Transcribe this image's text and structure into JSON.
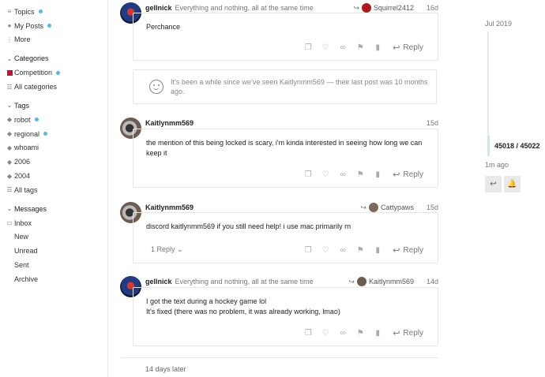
{
  "sidebar": {
    "top": [
      {
        "label": "Topics",
        "icon": "topics-icon",
        "dot": true
      },
      {
        "label": "My Posts",
        "icon": "user-icon",
        "dot": true
      },
      {
        "label": "More",
        "icon": "more-icon",
        "dot": false
      }
    ],
    "categories_title": "Categories",
    "categories": [
      {
        "label": "Competition",
        "icon": "category-square",
        "dot": true
      },
      {
        "label": "All categories",
        "icon": "list-icon",
        "dot": false
      }
    ],
    "tags_title": "Tags",
    "tags": [
      {
        "label": "robot",
        "dot": true
      },
      {
        "label": "regional",
        "dot": true
      },
      {
        "label": "whoami",
        "dot": false
      },
      {
        "label": "2006",
        "dot": false
      },
      {
        "label": "2004",
        "dot": false
      },
      {
        "label": "All tags",
        "dot": false
      }
    ],
    "messages_title": "Messages",
    "messages": [
      {
        "label": "Inbox"
      },
      {
        "label": "New"
      },
      {
        "label": "Unread"
      },
      {
        "label": "Sent"
      },
      {
        "label": "Archive"
      }
    ]
  },
  "posts": [
    {
      "username": "gellnick",
      "user_title": "Everything and nothing, all at the same time",
      "reply_to": "Squirrel2412",
      "age": "16d",
      "body": [
        "Perchance"
      ],
      "reply_label": "Reply",
      "replies": ""
    },
    {
      "username": "Kaitlynmm569",
      "user_title": "",
      "reply_to": "",
      "age": "15d",
      "body": [
        "the mention of this being locked is scary, i'm kinda interested in seeing how long we can keep it"
      ],
      "reply_label": "Reply",
      "replies": ""
    },
    {
      "username": "Kaitlynmm569",
      "user_title": "",
      "reply_to": "Cattypaws",
      "age": "15d",
      "body": [
        "discord kaitlynmm569 if you still need help! i use mac primarily rn"
      ],
      "reply_label": "Reply",
      "replies": "1 Reply"
    },
    {
      "username": "gellnick",
      "user_title": "Everything and nothing, all at the same time",
      "reply_to": "Kaitlynmm569",
      "age": "14d",
      "body": [
        "I got the text during a hockey game lol",
        "It's fixed (there was no problem, it was already working, lmao)"
      ],
      "reply_label": "Reply",
      "replies": ""
    }
  ],
  "gap_notice": "It’s been a while since we’ve seen Kaitlynmm569 — their last post was 10 months ago.",
  "days_later": "14 days later",
  "timeline": {
    "date": "Jul 2019",
    "count": "45018 / 45022",
    "ago": "1m ago"
  },
  "colors": {
    "accent_dot": "#55b9ea",
    "competition": "#c8102e"
  }
}
